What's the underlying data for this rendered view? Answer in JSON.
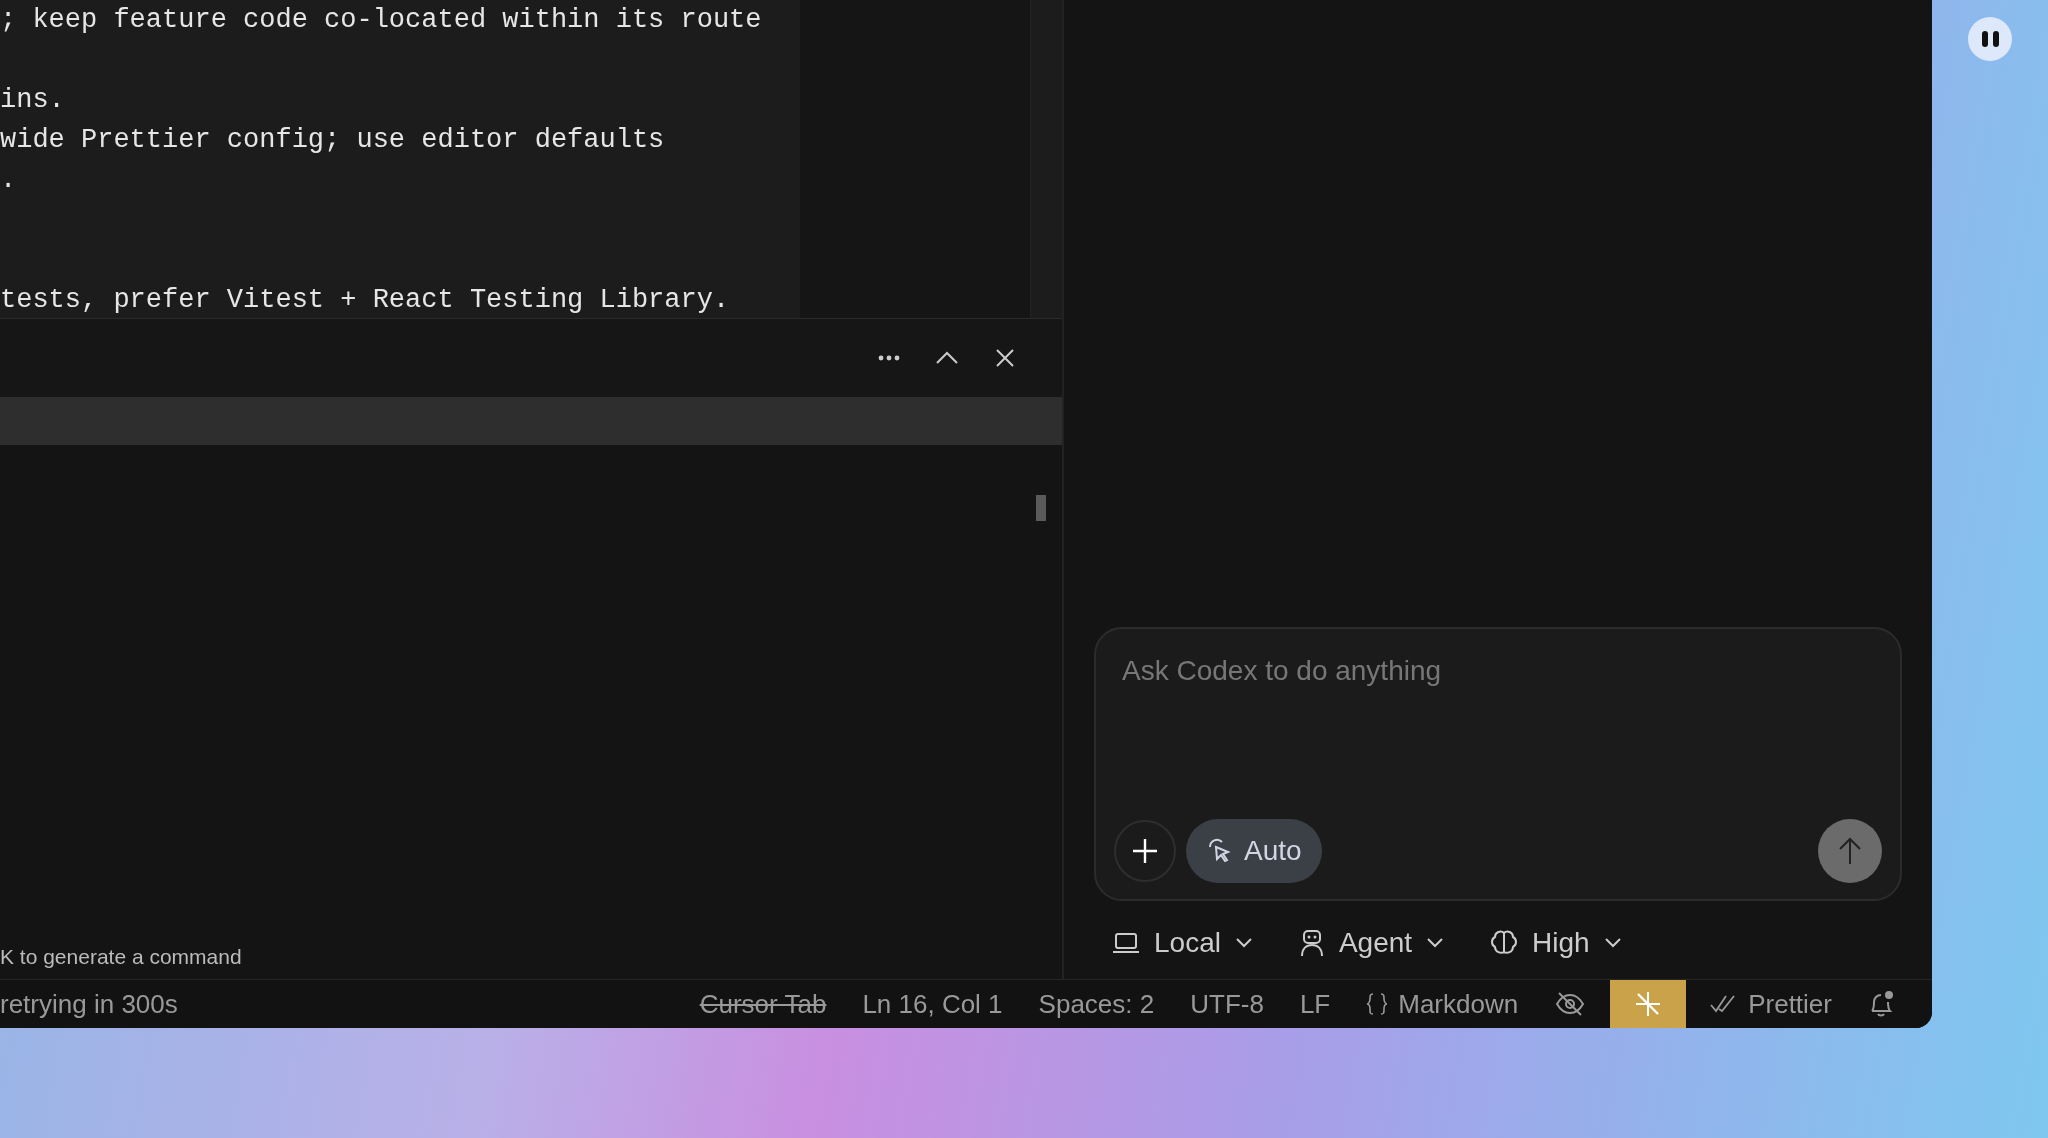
{
  "editor": {
    "lines": [
      {
        "kind": "text",
        "text": "; keep feature code co-located within its route"
      },
      {
        "kind": "blank"
      },
      {
        "kind": "text",
        "text": "ins."
      },
      {
        "kind": "text",
        "text": "wide Prettier config; use editor defaults"
      },
      {
        "kind": "text",
        "text": "."
      },
      {
        "kind": "blank"
      },
      {
        "kind": "blank"
      },
      {
        "kind": "text",
        "text": "tests, prefer Vitest + React Testing Library."
      }
    ]
  },
  "terminal": {
    "hint": "K to generate a command"
  },
  "chat": {
    "placeholder": "Ask Codex to do anything",
    "mode": "Auto",
    "options": [
      {
        "kind": "laptop",
        "label": "Local"
      },
      {
        "kind": "robot",
        "label": "Agent"
      },
      {
        "kind": "brain",
        "label": "High"
      }
    ]
  },
  "status_bar": {
    "left": "retrying in 300s",
    "items": [
      {
        "kind": "struck",
        "text": "Cursor Tab"
      },
      {
        "kind": "text",
        "text": "Ln 16, Col 1"
      },
      {
        "kind": "text",
        "text": "Spaces: 2"
      },
      {
        "kind": "text",
        "text": "UTF-8"
      },
      {
        "kind": "text",
        "text": "LF"
      },
      {
        "kind": "language",
        "text": "Markdown"
      },
      {
        "kind": "eye-off"
      },
      {
        "kind": "highlight"
      },
      {
        "kind": "check",
        "text": "Prettier"
      },
      {
        "kind": "bell"
      }
    ]
  }
}
